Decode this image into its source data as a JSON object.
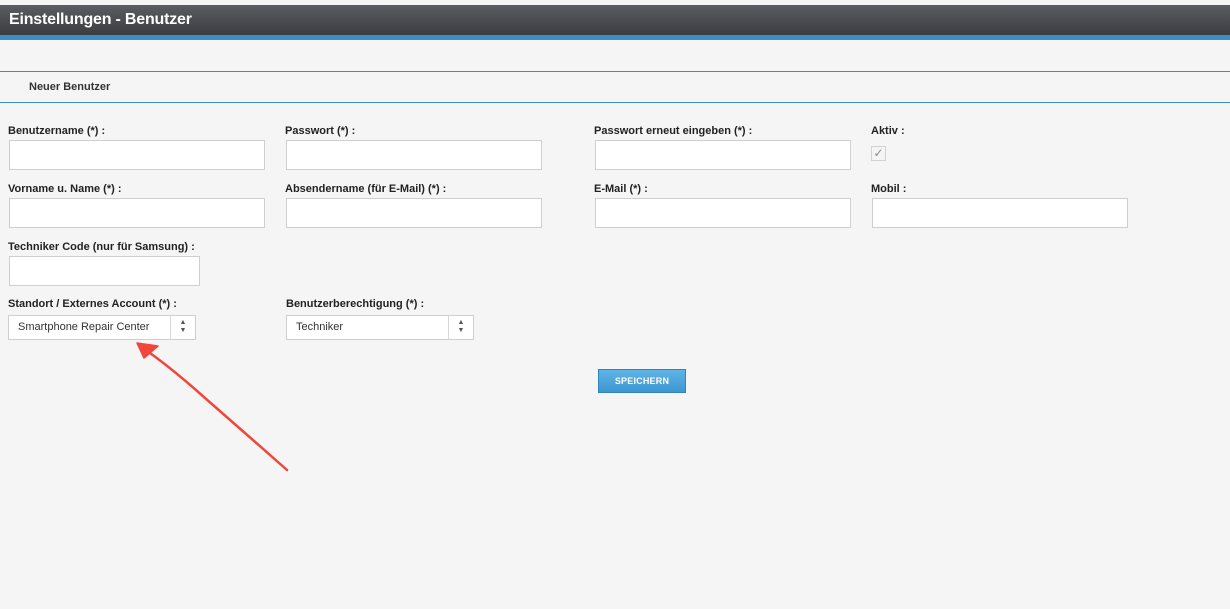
{
  "header": {
    "title": "Einstellungen - Benutzer"
  },
  "section": {
    "title": "Neuer Benutzer"
  },
  "form": {
    "username_label": "Benutzername (*) :",
    "password_label": "Passwort (*) :",
    "password_repeat_label": "Passwort erneut eingeben (*) :",
    "active_label": "Aktiv :",
    "active_checked": true,
    "fullname_label": "Vorname u. Name (*) :",
    "sender_name_label": "Absendername (für E-Mail) (*) :",
    "email_label": "E-Mail (*) :",
    "mobile_label": "Mobil :",
    "tech_code_label": "Techniker Code (nur für Samsung) :",
    "location_label": "Standort / Externes Account (*) :",
    "location_value": "Smartphone Repair Center",
    "permission_label": "Benutzerberechtigung (*) :",
    "permission_value": "Techniker",
    "save_label": "SPEICHERN"
  },
  "colors": {
    "accent": "#3a8fc4",
    "header_bg": "#4a4c50",
    "button_bg": "#4aa3db",
    "annotation_arrow": "#f0463c"
  },
  "icons": {
    "checkbox": "check-icon",
    "select_arrows": "up-down-arrows-icon",
    "annotation": "red-arrow-annotation"
  }
}
